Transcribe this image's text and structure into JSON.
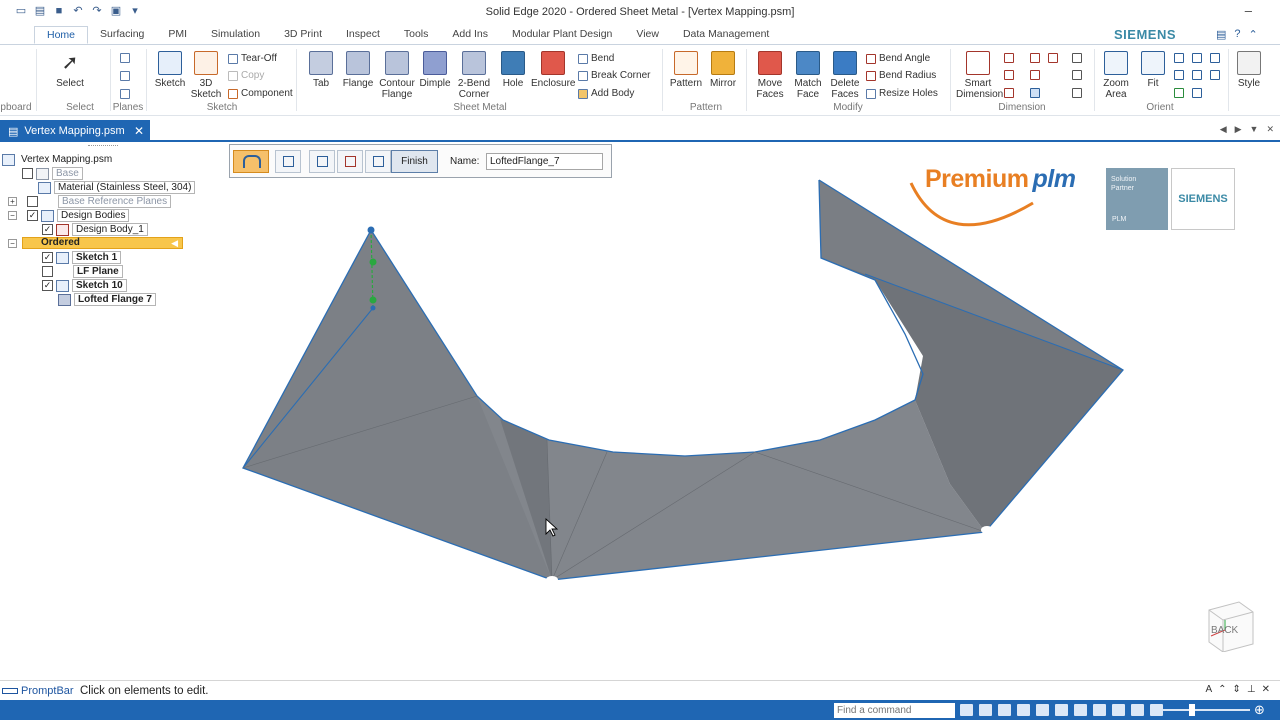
{
  "window": {
    "title": "Solid Edge 2020 - Ordered Sheet Metal - [Vertex Mapping.psm]",
    "minimize_glyph": "–"
  },
  "ribbon_tabs": [
    {
      "label": "Home",
      "active": true
    },
    {
      "label": "Surfacing"
    },
    {
      "label": "PMI"
    },
    {
      "label": "Simulation"
    },
    {
      "label": "3D Print"
    },
    {
      "label": "Inspect"
    },
    {
      "label": "Tools"
    },
    {
      "label": "Add Ins"
    },
    {
      "label": "Modular Plant Design"
    },
    {
      "label": "View"
    },
    {
      "label": "Data Management"
    }
  ],
  "brand": {
    "siemens": "SIEMENS",
    "accent": "#1f66b3"
  },
  "ribbon": {
    "clipboard_label": "pboard",
    "select": {
      "button": "Select",
      "group": "Select"
    },
    "planes_group": "Planes",
    "sketch": {
      "sketch": "Sketch",
      "sketch3d_1": "3D",
      "sketch3d_2": "Sketch",
      "tear_off": "Tear-Off",
      "copy": "Copy",
      "component": "Component",
      "group": "Sketch"
    },
    "sheet_metal": {
      "tab": "Tab",
      "flange": "Flange",
      "contour_1": "Contour",
      "contour_2": "Flange",
      "dimple": "Dimple",
      "bend2_1": "2-Bend",
      "bend2_2": "Corner",
      "hole": "Hole",
      "enclosure": "Enclosure",
      "bend": "Bend",
      "break_corner": "Break Corner",
      "add_body": "Add Body",
      "group": "Sheet Metal"
    },
    "pattern": {
      "pattern": "Pattern",
      "mirror": "Mirror",
      "group": "Pattern"
    },
    "modify": {
      "move_1": "Move",
      "move_2": "Faces",
      "match_1": "Match",
      "match_2": "Face",
      "delete_1": "Delete",
      "delete_2": "Faces",
      "bend_angle": "Bend Angle",
      "bend_radius": "Bend Radius",
      "resize_holes": "Resize Holes",
      "group": "Modify"
    },
    "dimension": {
      "smart_1": "Smart",
      "smart_2": "Dimension",
      "group": "Dimension"
    },
    "orient": {
      "zoom_1": "Zoom",
      "zoom_2": "Area",
      "fit": "Fit",
      "group": "Orient"
    },
    "style": "Style"
  },
  "document_tab": {
    "label": "Vertex Mapping.psm",
    "close": "✕"
  },
  "tree": {
    "root": "Vertex Mapping.psm",
    "base": "Base",
    "material": "Material (Stainless Steel, 304)",
    "base_ref_planes": "Base Reference Planes",
    "design_bodies": "Design Bodies",
    "design_body_1": "Design Body_1",
    "ordered": "Ordered",
    "sketch1": "Sketch 1",
    "lf_plane": "LF Plane",
    "sketch10": "Sketch 10",
    "lofted_flange": "Lofted Flange 7"
  },
  "command_bar": {
    "finish": "Finish",
    "name_label": "Name:",
    "name_value": "LoftedFlange_7"
  },
  "branding": {
    "premium": "Premium",
    "plm": "plm",
    "partner_line1": "Solution",
    "partner_line2": "Partner",
    "partner_plm": "PLM",
    "siemens_box": "SIEMENS"
  },
  "view_cube": {
    "label": "BACK"
  },
  "prompt": {
    "title": "PromptBar",
    "message": "Click on elements to edit."
  },
  "status": {
    "find_placeholder": "Find a command"
  }
}
